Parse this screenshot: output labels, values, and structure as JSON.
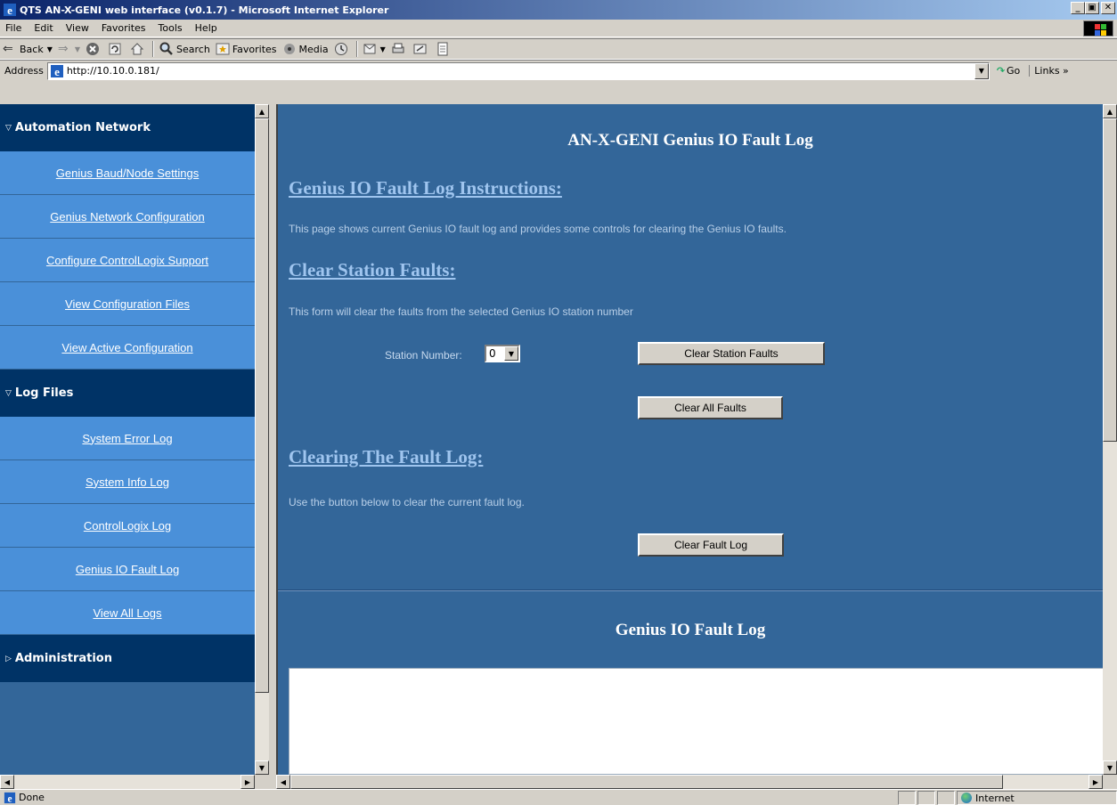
{
  "window": {
    "title": "QTS AN-X-GENI web interface (v0.1.7) - Microsoft Internet Explorer",
    "minimize": "_",
    "maximize": "̅",
    "close": "x"
  },
  "menu": [
    "File",
    "Edit",
    "View",
    "Favorites",
    "Tools",
    "Help"
  ],
  "toolbar": {
    "back": "Back",
    "search": "Search",
    "favorites": "Favorites",
    "media": "Media"
  },
  "address": {
    "label": "Address",
    "url": "http://10.10.0.181/",
    "go": "Go",
    "links": "Links"
  },
  "nav": {
    "sections": [
      {
        "title": "Automation Network",
        "expanded": true,
        "items": [
          "Genius Baud/Node Settings",
          "Genius Network Configuration",
          "Configure ControlLogix Support",
          "View Configuration Files",
          "View Active Configuration"
        ]
      },
      {
        "title": "Log Files",
        "expanded": true,
        "items": [
          "System Error Log",
          "System Info Log",
          "ControlLogix Log",
          "Genius IO Fault Log",
          "View All Logs"
        ]
      },
      {
        "title": "Administration",
        "expanded": false,
        "items": []
      }
    ]
  },
  "content": {
    "page_title": "AN-X-GENI Genius IO Fault Log",
    "instructions_title": "Genius IO Fault Log Instructions:",
    "instructions_text": "This page shows current Genius IO fault log and provides some controls for clearing the Genius IO faults.",
    "clear_station_title": "Clear Station Faults:",
    "clear_station_text": "This form will clear the faults from the selected Genius IO station number",
    "station_label": "Station Number:",
    "station_value": "0",
    "clear_station_button": "Clear Station Faults",
    "clear_all_button": "Clear All Faults",
    "clearing_log_title": "Clearing The Fault Log:",
    "clearing_log_text": "Use the button below to clear the current fault log.",
    "clear_log_button": "Clear Fault Log",
    "log_title": "Genius IO Fault Log"
  },
  "status": {
    "text": "Done",
    "zone": "Internet"
  },
  "colors": {
    "page_bg": "#336699",
    "nav_header": "#003366",
    "nav_item": "#4a90d9",
    "section_title": "#9fc5ef"
  }
}
